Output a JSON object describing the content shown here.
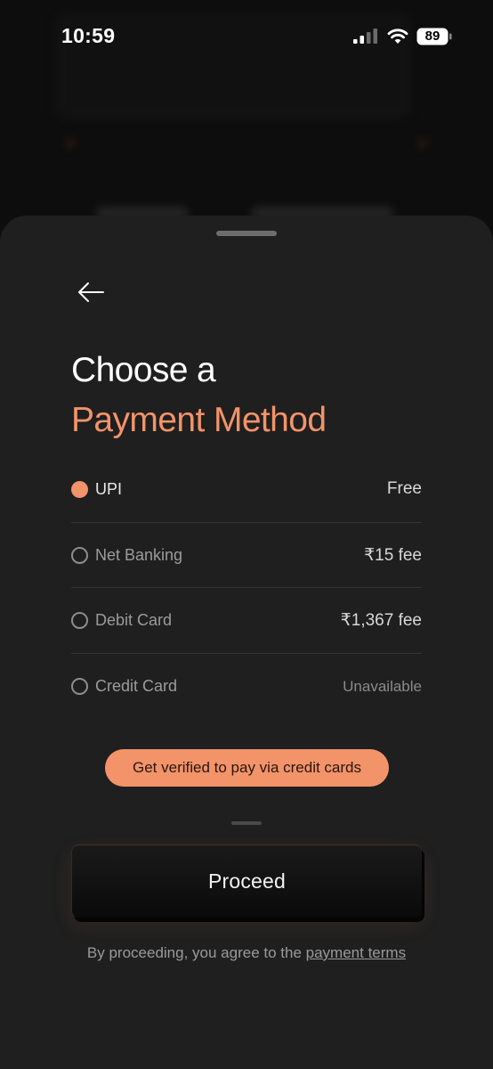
{
  "status_bar": {
    "time": "10:59",
    "battery": "89"
  },
  "sheet": {
    "title_line1": "Choose a",
    "title_line2": "Payment Method",
    "accent_color": "#f3936a",
    "methods": [
      {
        "label": "UPI",
        "fee": "Free",
        "selected": true
      },
      {
        "label": "Net Banking",
        "fee": "₹15 fee",
        "selected": false
      },
      {
        "label": "Debit Card",
        "fee": "₹1,367 fee",
        "selected": false
      },
      {
        "label": "Credit Card",
        "fee": "Unavailable",
        "selected": false
      }
    ],
    "verify_button": "Get verified to pay via credit cards",
    "proceed_button": "Proceed",
    "terms_prefix": "By proceeding, you agree to the ",
    "terms_link": "payment terms"
  }
}
